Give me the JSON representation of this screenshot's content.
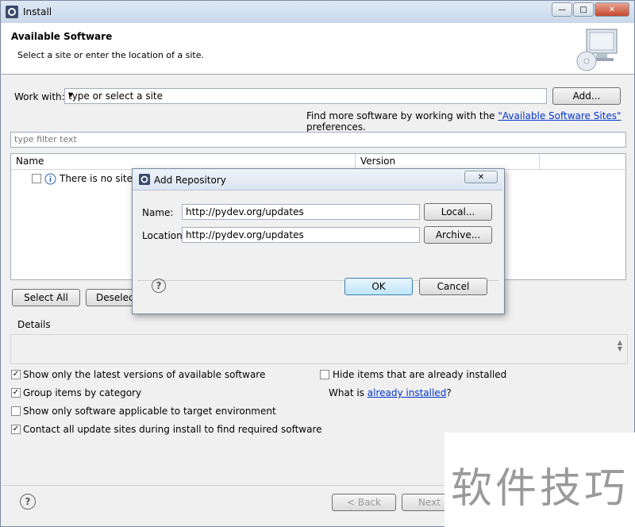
{
  "window": {
    "title": "Install",
    "header_title": "Available Software",
    "header_subtitle": "Select a site or enter the location of a site."
  },
  "work_with": {
    "label": "Work with:",
    "value": "type or select a site",
    "add_button": "Add...",
    "find_more_prefix": "Find more software by working with the",
    "find_more_link": "\"Available Software Sites\"",
    "find_more_suffix": "preferences."
  },
  "filter": {
    "placeholder": "type filter text"
  },
  "table": {
    "columns": [
      "Name",
      "Version"
    ],
    "row_text": "There is no site sel"
  },
  "buttons": {
    "select_all": "Select All",
    "deselect": "Deselect",
    "back": "< Back",
    "next": "Next"
  },
  "details": {
    "label": "Details"
  },
  "options": {
    "latest_versions": "Show only the latest versions of available software",
    "group_by_category": "Group items by category",
    "applicable_target": "Show only software applicable to target environment",
    "contact_sites": "Contact all update sites during install to find required software",
    "hide_installed": "Hide items that are already installed",
    "what_is_prefix": "What is",
    "already_installed_link": "already installed",
    "what_is_suffix": "?"
  },
  "dialog": {
    "title": "Add Repository",
    "name_label": "Name:",
    "name_value": "http://pydev.org/updates",
    "location_label": "Location:",
    "location_value": "http://pydev.org/updates",
    "local_button": "Local...",
    "archive_button": "Archive...",
    "ok_button": "OK",
    "cancel_button": "Cancel"
  },
  "watermark": "软件技巧"
}
